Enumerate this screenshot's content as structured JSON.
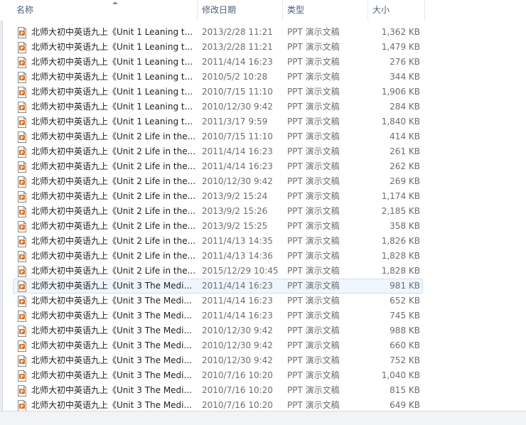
{
  "columns": {
    "name": "名称",
    "date": "修改日期",
    "type": "类型",
    "size": "大小"
  },
  "files": [
    {
      "name": "北师大初中英语九上《Unit 1 Leaning t...",
      "date": "2013/2/28 11:21",
      "type": "PPT 演示文稿",
      "size": "1,362 KB"
    },
    {
      "name": "北师大初中英语九上《Unit 1 Leaning t...",
      "date": "2013/2/28 11:21",
      "type": "PPT 演示文稿",
      "size": "1,479 KB"
    },
    {
      "name": "北师大初中英语九上《Unit 1 Leaning t...",
      "date": "2011/4/14 16:23",
      "type": "PPT 演示文稿",
      "size": "276 KB"
    },
    {
      "name": "北师大初中英语九上《Unit 1 Leaning t...",
      "date": "2010/5/2 10:28",
      "type": "PPT 演示文稿",
      "size": "344 KB"
    },
    {
      "name": "北师大初中英语九上《Unit 1 Leaning t...",
      "date": "2010/7/15 11:10",
      "type": "PPT 演示文稿",
      "size": "1,906 KB"
    },
    {
      "name": "北师大初中英语九上《Unit 1 Leaning t...",
      "date": "2010/12/30 9:42",
      "type": "PPT 演示文稿",
      "size": "284 KB"
    },
    {
      "name": "北师大初中英语九上《Unit 1 Leaning t...",
      "date": "2011/3/17 9:59",
      "type": "PPT 演示文稿",
      "size": "1,840 KB"
    },
    {
      "name": "北师大初中英语九上《Unit 2 Life in the...",
      "date": "2010/7/15 11:10",
      "type": "PPT 演示文稿",
      "size": "414 KB"
    },
    {
      "name": "北师大初中英语九上《Unit 2 Life in the...",
      "date": "2011/4/14 16:23",
      "type": "PPT 演示文稿",
      "size": "261 KB"
    },
    {
      "name": "北师大初中英语九上《Unit 2 Life in the...",
      "date": "2011/4/14 16:23",
      "type": "PPT 演示文稿",
      "size": "262 KB"
    },
    {
      "name": "北师大初中英语九上《Unit 2 Life in the...",
      "date": "2010/12/30 9:42",
      "type": "PPT 演示文稿",
      "size": "269 KB"
    },
    {
      "name": "北师大初中英语九上《Unit 2 Life in the...",
      "date": "2013/9/2 15:24",
      "type": "PPT 演示文稿",
      "size": "1,174 KB"
    },
    {
      "name": "北师大初中英语九上《Unit 2 Life in the...",
      "date": "2013/9/2 15:26",
      "type": "PPT 演示文稿",
      "size": "2,185 KB"
    },
    {
      "name": "北师大初中英语九上《Unit 2 Life in the...",
      "date": "2013/9/2 15:25",
      "type": "PPT 演示文稿",
      "size": "358 KB"
    },
    {
      "name": "北师大初中英语九上《Unit 2 Life in the...",
      "date": "2011/4/13 14:35",
      "type": "PPT 演示文稿",
      "size": "1,826 KB"
    },
    {
      "name": "北师大初中英语九上《Unit 2 Life in the...",
      "date": "2011/4/13 14:36",
      "type": "PPT 演示文稿",
      "size": "1,828 KB"
    },
    {
      "name": "北师大初中英语九上《Unit 2 Life in the...",
      "date": "2015/12/29 10:45",
      "type": "PPT 演示文稿",
      "size": "1,828 KB"
    },
    {
      "name": "北师大初中英语九上《Unit 3 The Medi...",
      "date": "2011/4/14 16:23",
      "type": "PPT 演示文稿",
      "size": "981 KB",
      "selected": true
    },
    {
      "name": "北师大初中英语九上《Unit 3 The Medi...",
      "date": "2011/4/14 16:23",
      "type": "PPT 演示文稿",
      "size": "652 KB"
    },
    {
      "name": "北师大初中英语九上《Unit 3 The Medi...",
      "date": "2011/4/14 16:23",
      "type": "PPT 演示文稿",
      "size": "745 KB"
    },
    {
      "name": "北师大初中英语九上《Unit 3 The Medi...",
      "date": "2010/12/30 9:42",
      "type": "PPT 演示文稿",
      "size": "988 KB"
    },
    {
      "name": "北师大初中英语九上《Unit 3 The Medi...",
      "date": "2010/12/30 9:42",
      "type": "PPT 演示文稿",
      "size": "660 KB"
    },
    {
      "name": "北师大初中英语九上《Unit 3 The Medi...",
      "date": "2010/12/30 9:42",
      "type": "PPT 演示文稿",
      "size": "752 KB"
    },
    {
      "name": "北师大初中英语九上《Unit 3 The Medi...",
      "date": "2010/7/16 10:20",
      "type": "PPT 演示文稿",
      "size": "1,040 KB"
    },
    {
      "name": "北师大初中英语九上《Unit 3 The Medi...",
      "date": "2010/7/16 10:20",
      "type": "PPT 演示文稿",
      "size": "815 KB"
    },
    {
      "name": "北师大初中英语九上《Unit 3 The Medi...",
      "date": "2010/7/16 10:20",
      "type": "PPT 演示文稿",
      "size": "649 KB"
    }
  ],
  "icon": "ppt-file-icon",
  "colors": {
    "header_text": "#4c607a",
    "selection_bg": "#f0f6fd",
    "selection_border": "#cde0f7",
    "icon_orange": "#d86a1e"
  }
}
